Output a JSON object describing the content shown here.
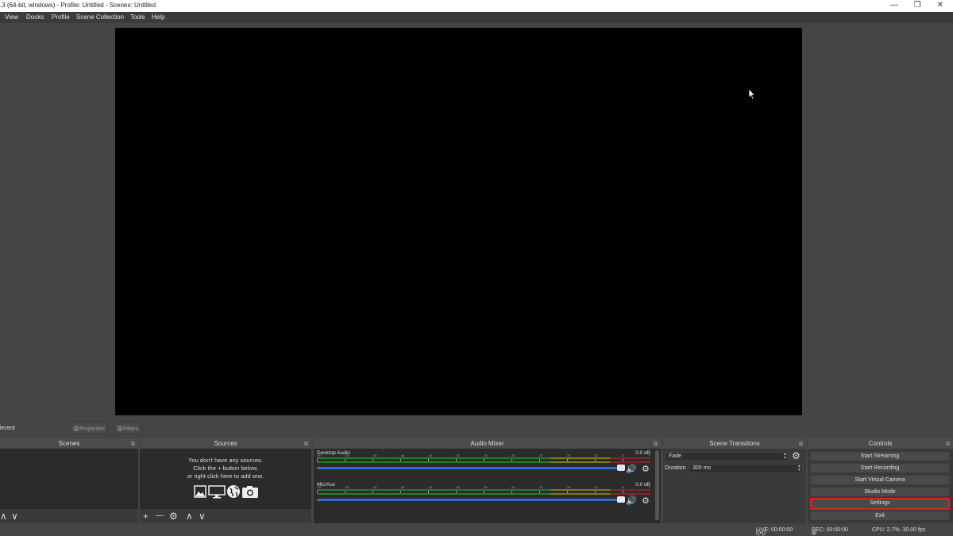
{
  "window": {
    "title": ".3 (64-bit, windows) - Profile: Untitled - Scenes: Untitled",
    "minimize": "—",
    "restore": "❐",
    "close": "✕"
  },
  "menu": {
    "items": [
      "View",
      "Docks",
      "Profile",
      "Scene Collection",
      "Tools",
      "Help"
    ]
  },
  "source_toolbar": {
    "no_selection": "lected",
    "properties": "Properties",
    "filters": "Filters"
  },
  "scenes": {
    "title": "Scenes",
    "up": "∧",
    "down": "∨"
  },
  "sources": {
    "title": "Sources",
    "empty_line1": "You don't have any sources.",
    "empty_line2": "Click the + button below,",
    "empty_line3": "or right click here to add one.",
    "add": "+",
    "remove": "—",
    "settings": "⚙",
    "up": "∧",
    "down": "∨"
  },
  "audio_mixer": {
    "title": "Audio Mixer",
    "channels": [
      {
        "name": "Desktop Audio",
        "db": "0.0 dB",
        "volume": 1.0
      },
      {
        "name": "Mic/Aux",
        "db": "0.0 dB",
        "volume": 1.0
      }
    ],
    "tick_labels": [
      "-60",
      "-55",
      "-50",
      "-45",
      "-40",
      "-35",
      "-30",
      "-25",
      "-20",
      "-15",
      "-10",
      "-5",
      "0"
    ]
  },
  "scene_transitions": {
    "title": "Scene Transitions",
    "transition": "Fade",
    "duration_label": "Duration",
    "duration_value": "300 ms"
  },
  "controls": {
    "title": "Controls",
    "start_streaming": "Start Streaming",
    "start_recording": "Start Recording",
    "start_virtual_camera": "Start Virtual Camera",
    "studio_mode": "Studio Mode",
    "settings": "Settings",
    "exit": "Exit"
  },
  "status": {
    "live": "LIVE: 00:00:00",
    "rec": "REC: 00:00:00",
    "cpu": "CPU: 2.7%, 30.00 fps"
  },
  "colors": {
    "highlight": "#e02020",
    "fader": "#2f6fd0"
  }
}
